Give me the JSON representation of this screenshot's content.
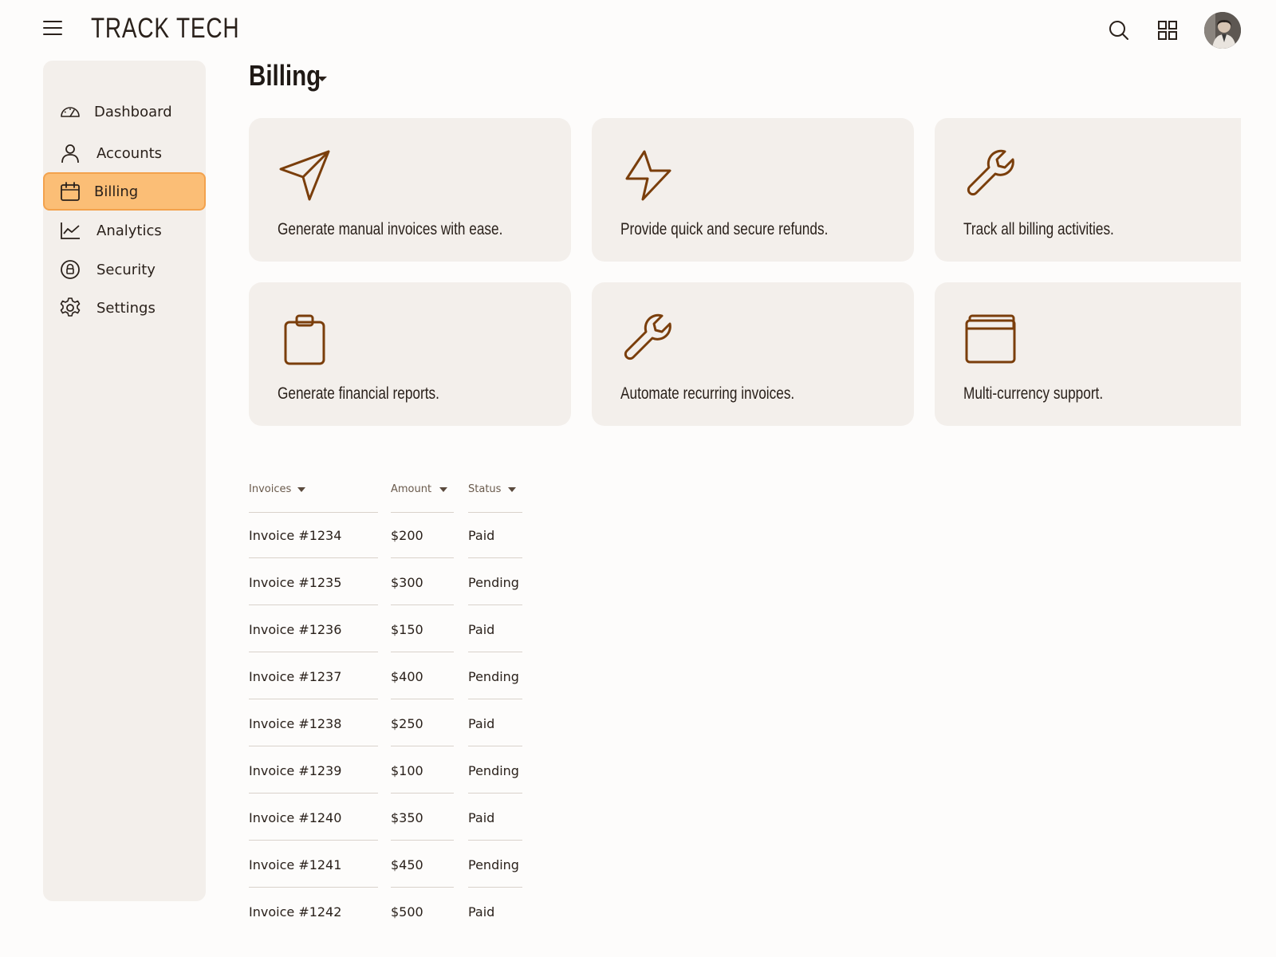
{
  "app": {
    "brand": "TRACK TECH"
  },
  "topbar": {
    "menu_icon": "hamburger-menu-icon",
    "search_icon": "search-icon",
    "apps_icon": "grid-apps-icon",
    "avatar": "user-avatar"
  },
  "sidebar": {
    "items": [
      {
        "label": "Dashboard",
        "icon": "gauge-icon",
        "active": false
      },
      {
        "label": "Accounts",
        "icon": "user-icon",
        "active": false
      },
      {
        "label": "Billing",
        "icon": "calendar-icon",
        "active": true
      },
      {
        "label": "Analytics",
        "icon": "line-chart-icon",
        "active": false
      },
      {
        "label": "Security",
        "icon": "lock-circle-icon",
        "active": false
      },
      {
        "label": "Settings",
        "icon": "gear-icon",
        "active": false
      }
    ]
  },
  "page": {
    "title": "Billing"
  },
  "cards": [
    {
      "text": "Generate manual invoices with ease.",
      "icon": "send-icon"
    },
    {
      "text": "Provide quick and secure refunds.",
      "icon": "lightning-icon"
    },
    {
      "text": "Track all billing activities.",
      "icon": "wrench-icon"
    },
    {
      "text": "Generate financial reports.",
      "icon": "clipboard-icon"
    },
    {
      "text": "Automate recurring invoices.",
      "icon": "wrench-icon"
    },
    {
      "text": "Multi-currency support.",
      "icon": "wallet-icon"
    }
  ],
  "table": {
    "headers": [
      "Invoices",
      "Amount",
      "Status"
    ],
    "rows": [
      [
        "Invoice #1234",
        "$200",
        "Paid"
      ],
      [
        "Invoice #1235",
        "$300",
        "Pending"
      ],
      [
        "Invoice #1236",
        "$150",
        "Paid"
      ],
      [
        "Invoice #1237",
        "$400",
        "Pending"
      ],
      [
        "Invoice #1238",
        "$250",
        "Paid"
      ],
      [
        "Invoice #1239",
        "$100",
        "Pending"
      ],
      [
        "Invoice #1240",
        "$350",
        "Paid"
      ],
      [
        "Invoice #1241",
        "$450",
        "Pending"
      ],
      [
        "Invoice #1242",
        "$500",
        "Paid"
      ]
    ]
  },
  "colors": {
    "accent": "#fbbe76",
    "accent_border": "#f3a24d",
    "icon_brown": "#7a3e0b",
    "panel": "#f3efeb",
    "background": "#fdfcfb"
  }
}
